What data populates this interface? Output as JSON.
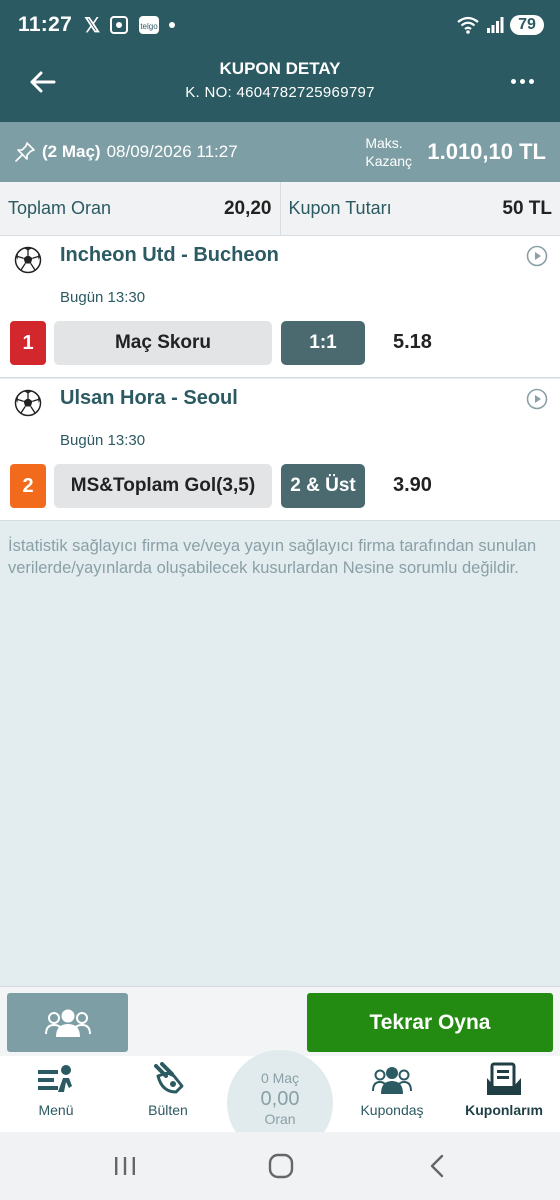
{
  "status_bar": {
    "time": "11:27",
    "icons": [
      "x-icon",
      "screenshot-icon",
      "telegram-app-icon",
      "notification-dot"
    ],
    "app_badge": "telgo",
    "battery": "79"
  },
  "header": {
    "title": "KUPON DETAY",
    "coupon_no": "K. NO: 4604782725969797"
  },
  "info": {
    "match_count": "(2 Maç)",
    "datetime": "08/09/2026 11:27",
    "max_label_line1": "Maks.",
    "max_label_line2": "Kazanç",
    "max_value": "1.010,10 TL"
  },
  "totals": {
    "total_odds_label": "Toplam Oran",
    "total_odds_value": "20,20",
    "stake_label": "Kupon Tutarı",
    "stake_value": "50 TL"
  },
  "matches": [
    {
      "title": "Incheon Utd - Bucheon",
      "time": "Bugün 13:30",
      "number": "1",
      "number_color": "#d3272e",
      "market": "Maç Skoru",
      "pick": "1:1",
      "odds": "5.18"
    },
    {
      "title": "Ulsan Hora - Seoul",
      "time": "Bugün 13:30",
      "number": "2",
      "number_color": "#f26b1d",
      "market": "MS&Toplam Gol(3,5)",
      "pick": "2 & Üst",
      "odds": "3.90"
    }
  ],
  "disclaimer": "İstatistik sağlayıcı firma ve/veya yayın sağlayıcı firma tarafından sunulan verilerde/yayınlarda oluşabilecek kusurlardan Nesine sorumlu değildir.",
  "actions": {
    "replay_label": "Tekrar Oyna"
  },
  "nav": {
    "menu": "Menü",
    "bulletin": "Bülten",
    "slip_count": "0 Maç",
    "slip_odds": "0,00",
    "slip_label": "Oran",
    "kupondas": "Kupondaş",
    "kuponlarim": "Kuponlarım"
  },
  "colors": {
    "header": "#2c5a62",
    "info_band": "#7e9ea5",
    "replay": "#238a12",
    "pick_box": "#4a6a70"
  }
}
